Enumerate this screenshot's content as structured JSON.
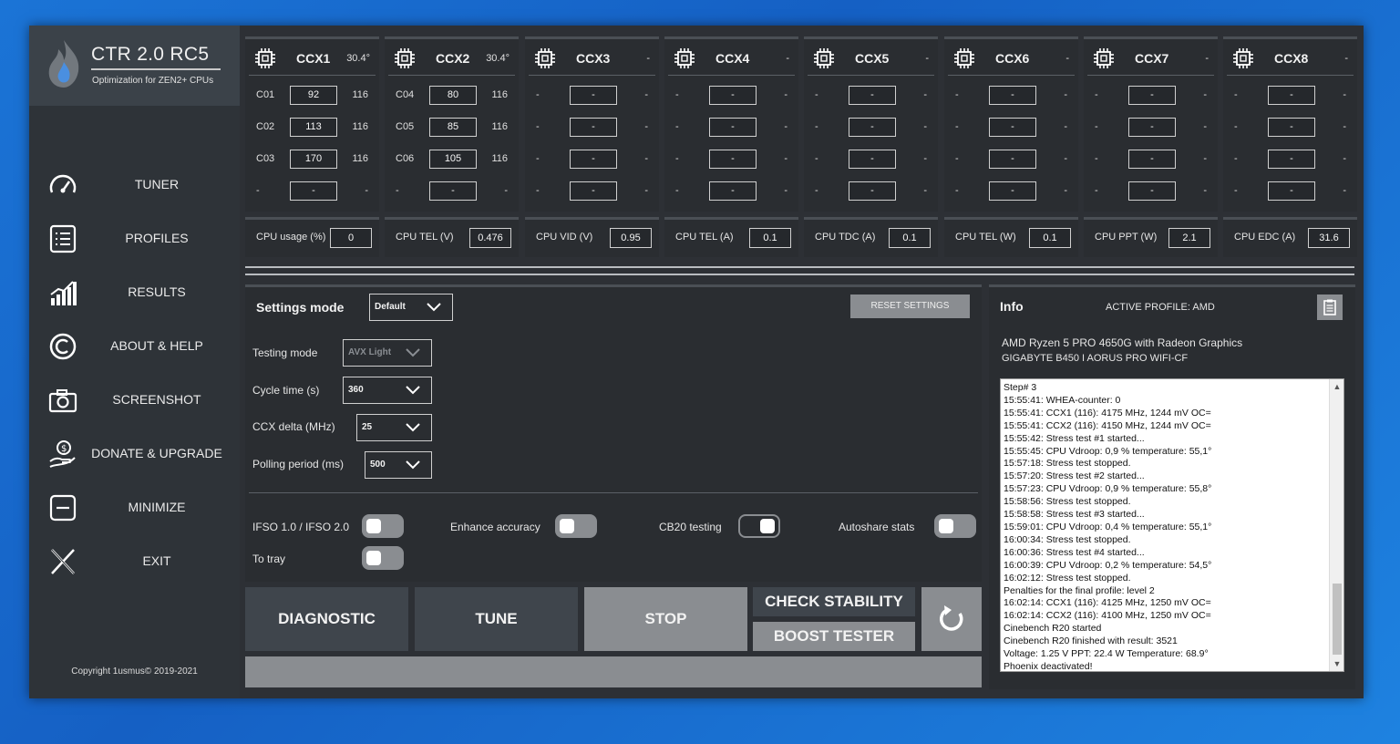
{
  "app": {
    "title": "CTR 2.0 RC5",
    "subtitle": "Optimization for ZEN2+ CPUs",
    "copyright": "Copyright 1usmus© 2019-2021"
  },
  "nav": [
    {
      "label": "TUNER",
      "icon": "gauge-icon"
    },
    {
      "label": "PROFILES",
      "icon": "list-icon"
    },
    {
      "label": "RESULTS",
      "icon": "chart-icon"
    },
    {
      "label": "ABOUT & HELP",
      "icon": "copyright-icon"
    },
    {
      "label": "SCREENSHOT",
      "icon": "camera-icon"
    },
    {
      "label": "DONATE & UPGRADE",
      "icon": "donate-icon"
    },
    {
      "label": "MINIMIZE",
      "icon": "minimize-icon"
    },
    {
      "label": "EXIT",
      "icon": "exit-icon"
    }
  ],
  "ccx": [
    {
      "name": "CCX1",
      "temp": "30.4°",
      "cores": [
        {
          "n": "C01",
          "v": "92",
          "m": "116"
        },
        {
          "n": "C02",
          "v": "113",
          "m": "116"
        },
        {
          "n": "C03",
          "v": "170",
          "m": "116"
        },
        {
          "n": "-",
          "v": "-",
          "m": "-"
        }
      ]
    },
    {
      "name": "CCX2",
      "temp": "30.4°",
      "cores": [
        {
          "n": "C04",
          "v": "80",
          "m": "116"
        },
        {
          "n": "C05",
          "v": "85",
          "m": "116"
        },
        {
          "n": "C06",
          "v": "105",
          "m": "116"
        },
        {
          "n": "-",
          "v": "-",
          "m": "-"
        }
      ]
    },
    {
      "name": "CCX3",
      "temp": "-",
      "cores": [
        {
          "n": "-",
          "v": "-",
          "m": "-"
        },
        {
          "n": "-",
          "v": "-",
          "m": "-"
        },
        {
          "n": "-",
          "v": "-",
          "m": "-"
        },
        {
          "n": "-",
          "v": "-",
          "m": "-"
        }
      ]
    },
    {
      "name": "CCX4",
      "temp": "-",
      "cores": [
        {
          "n": "-",
          "v": "-",
          "m": "-"
        },
        {
          "n": "-",
          "v": "-",
          "m": "-"
        },
        {
          "n": "-",
          "v": "-",
          "m": "-"
        },
        {
          "n": "-",
          "v": "-",
          "m": "-"
        }
      ]
    },
    {
      "name": "CCX5",
      "temp": "-",
      "cores": [
        {
          "n": "-",
          "v": "-",
          "m": "-"
        },
        {
          "n": "-",
          "v": "-",
          "m": "-"
        },
        {
          "n": "-",
          "v": "-",
          "m": "-"
        },
        {
          "n": "-",
          "v": "-",
          "m": "-"
        }
      ]
    },
    {
      "name": "CCX6",
      "temp": "-",
      "cores": [
        {
          "n": "-",
          "v": "-",
          "m": "-"
        },
        {
          "n": "-",
          "v": "-",
          "m": "-"
        },
        {
          "n": "-",
          "v": "-",
          "m": "-"
        },
        {
          "n": "-",
          "v": "-",
          "m": "-"
        }
      ]
    },
    {
      "name": "CCX7",
      "temp": "-",
      "cores": [
        {
          "n": "-",
          "v": "-",
          "m": "-"
        },
        {
          "n": "-",
          "v": "-",
          "m": "-"
        },
        {
          "n": "-",
          "v": "-",
          "m": "-"
        },
        {
          "n": "-",
          "v": "-",
          "m": "-"
        }
      ]
    },
    {
      "name": "CCX8",
      "temp": "-",
      "cores": [
        {
          "n": "-",
          "v": "-",
          "m": "-"
        },
        {
          "n": "-",
          "v": "-",
          "m": "-"
        },
        {
          "n": "-",
          "v": "-",
          "m": "-"
        },
        {
          "n": "-",
          "v": "-",
          "m": "-"
        }
      ]
    }
  ],
  "stats": [
    {
      "label": "CPU usage (%)",
      "value": "0"
    },
    {
      "label": "CPU TEL (V)",
      "value": "0.476"
    },
    {
      "label": "CPU VID (V)",
      "value": "0.95"
    },
    {
      "label": "CPU TEL (A)",
      "value": "0.1"
    },
    {
      "label": "CPU TDC (A)",
      "value": "0.1"
    },
    {
      "label": "CPU TEL (W)",
      "value": "0.1"
    },
    {
      "label": "CPU PPT (W)",
      "value": "2.1"
    },
    {
      "label": "CPU EDC (A)",
      "value": "31.6"
    }
  ],
  "settings": {
    "title": "Settings mode",
    "mode_value": "Default",
    "reset_label": "RESET SETTINGS",
    "testing_mode_label": "Testing mode",
    "testing_mode_value": "AVX Light",
    "cycle_time_label": "Cycle time (s)",
    "cycle_time_value": "360",
    "ccx_delta_label": "CCX delta (MHz)",
    "ccx_delta_value": "25",
    "polling_label": "Polling period (ms)",
    "polling_value": "500",
    "toggles": {
      "ifso_label": "IFSO 1.0 / IFSO 2.0",
      "enhance_label": "Enhance accuracy",
      "cb20_label": "CB20 testing",
      "autoshare_label": "Autoshare stats",
      "tray_label": "To tray"
    }
  },
  "actions": {
    "diagnostic": "DIAGNOSTIC",
    "tune": "TUNE",
    "stop": "STOP",
    "check_stability": "CHECK STABILITY",
    "boost_tester": "BOOST TESTER"
  },
  "info": {
    "title": "Info",
    "active_profile": "ACTIVE PROFILE: AMD",
    "cpu": "AMD Ryzen 5 PRO 4650G with Radeon Graphics",
    "motherboard": "GIGABYTE B450 I AORUS PRO WIFI-CF",
    "log": [
      "Step# 3",
      "15:55:41: WHEA-counter: 0",
      "15:55:41: CCX1 (116): 4175 MHz, 1244 mV  OC=",
      "15:55:41: CCX2 (116): 4150 MHz, 1244 mV  OC=",
      "15:55:42: Stress test #1 started...",
      "15:55:45: CPU Vdroop: 0,9 % temperature: 55,1°",
      "15:57:18: Stress test stopped.",
      "15:57:20: Stress test #2 started...",
      "15:57:23: CPU Vdroop: 0,9 % temperature: 55,8°",
      "15:58:56: Stress test stopped.",
      "15:58:58: Stress test #3 started...",
      "15:59:01: CPU Vdroop: 0,4 % temperature: 55,1°",
      "16:00:34: Stress test stopped.",
      "16:00:36: Stress test #4 started...",
      "16:00:39: CPU Vdroop: 0,2 % temperature: 54,5°",
      "16:02:12: Stress test stopped.",
      "Penalties for the final profile: level 2",
      "16:02:14: CCX1 (116): 4125 MHz, 1250 mV  OC=",
      "16:02:14: CCX2 (116): 4100 MHz, 1250 mV  OC=",
      "Cinebench R20 started",
      "Cinebench R20 finished with result: 3521",
      "Voltage: 1.25 V  PPT: 22.4 W  Temperature: 68.9°",
      "Phoenix deactivated!"
    ]
  },
  "colors": {
    "background": "#2d3035",
    "panel": "#2a2d31",
    "accent_gray": "#8a8d91",
    "button_dark": "#3f454c"
  }
}
